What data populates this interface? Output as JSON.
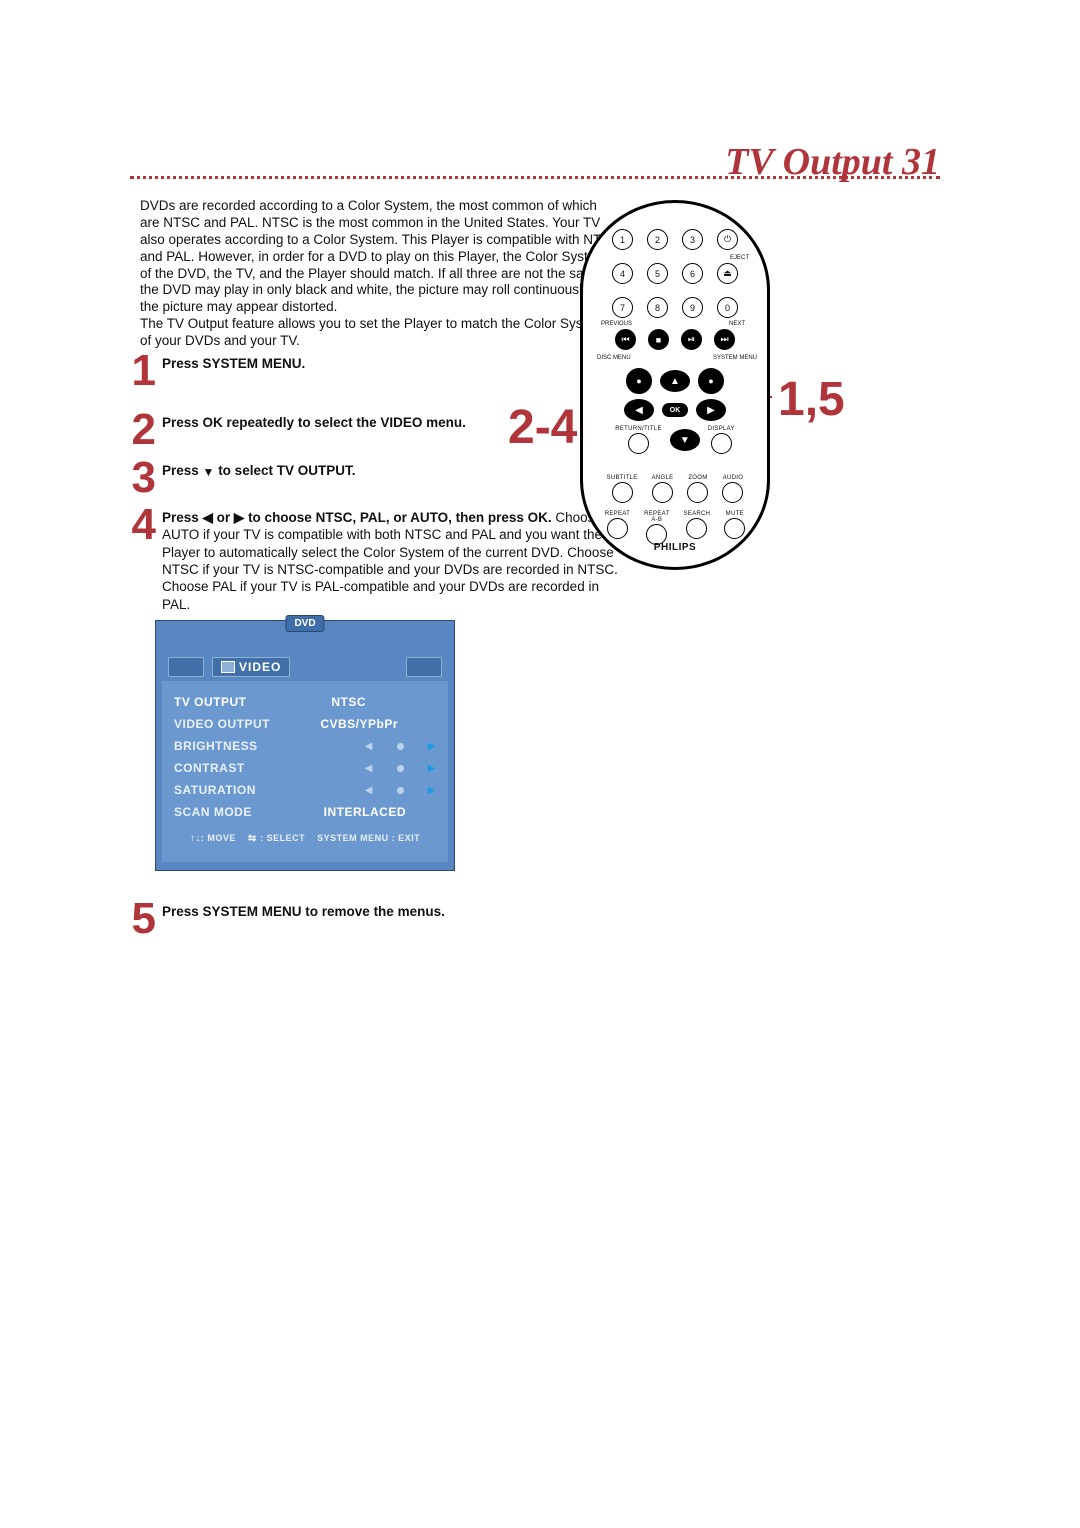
{
  "page": {
    "title": "TV Output",
    "page_number": "31"
  },
  "intro": {
    "p1": "DVDs are recorded according to a Color System, the most common of which are NTSC and PAL. NTSC is the most common in the United States. Your TV also operates according to a Color System. This Player is compatible with NTSC and PAL. However, in order for a DVD to play on this Player, the Color System of the DVD, the TV, and the Player should match. If all three are not the same, the DVD may play in only black and white, the picture may roll continuously,  or the picture may appear distorted.",
    "p2": "The TV Output feature allows you to set the Player to match the Color Systems of your DVDs and your TV."
  },
  "steps": [
    {
      "n": "1",
      "bold": "Press SYSTEM MENU.",
      "rest": ""
    },
    {
      "n": "2",
      "bold": "Press OK repeatedly to select the VIDEO menu.",
      "rest": ""
    },
    {
      "n": "3",
      "bold_pre": "Press ",
      "bold_arrow": "▼",
      "bold_post": "  to select TV OUTPUT.",
      "rest": ""
    },
    {
      "n": "4",
      "bold_pre": "Press ",
      "bold_arrow": "◀ or ▶",
      "bold_post": " to choose NTSC, PAL, or AUTO, then press OK.",
      "rest": " Choose AUTO if your TV is compatible with both NTSC and PAL and you want the Player to automatically select the Color System of the current DVD. Choose NTSC if your TV is NTSC-compatible and your DVDs are recorded in NTSC. Choose PAL if your TV is PAL-compatible and your DVDs are recorded in PAL."
    },
    {
      "n": "5",
      "bold": "Press SYSTEM MENU to remove the menus.",
      "rest": ""
    }
  ],
  "callouts": {
    "left": "2-4",
    "right": "1,5"
  },
  "remote": {
    "numpad": [
      [
        "1",
        "2",
        "3"
      ],
      [
        "4",
        "5",
        "6"
      ],
      [
        "7",
        "8",
        "9"
      ]
    ],
    "zero": "0",
    "power": "⏻",
    "eject_label": "EJECT",
    "eject": "⏏",
    "previous_label": "PREVIOUS",
    "next_label": "NEXT",
    "transport": [
      "⏮",
      "■",
      "⏯",
      "⏭"
    ],
    "disc_menu_label": "DISC MENU",
    "system_menu_label": "SYSTEM MENU",
    "ok": "OK",
    "return_label": "RETURN/TITLE",
    "display_label": "DISPLAY",
    "row_a_labels": [
      "SUBTITLE",
      "ANGLE",
      "ZOOM",
      "AUDIO"
    ],
    "row_b_labels": [
      "REPEAT",
      "REPEAT\nA-B",
      "SEARCH",
      "MUTE"
    ],
    "brand": "PHILIPS",
    "arrows": {
      "up": "▲",
      "down": "▼",
      "left": "◀",
      "right": "▶"
    }
  },
  "menu": {
    "header_tag": "DVD",
    "video_tab": "VIDEO",
    "items": [
      {
        "label": "TV OUTPUT",
        "type": "value",
        "value": "NTSC"
      },
      {
        "label": "VIDEO OUTPUT",
        "type": "value",
        "value": "CVBS/YPbPr"
      },
      {
        "label": "BRIGHTNESS",
        "type": "slider"
      },
      {
        "label": "CONTRAST",
        "type": "slider"
      },
      {
        "label": "SATURATION",
        "type": "slider"
      },
      {
        "label": "SCAN MODE",
        "type": "value",
        "value": "INTERLACED"
      }
    ],
    "hints": {
      "move": ": MOVE",
      "select": ": SELECT",
      "exit": "SYSTEM MENU : EXIT"
    }
  }
}
